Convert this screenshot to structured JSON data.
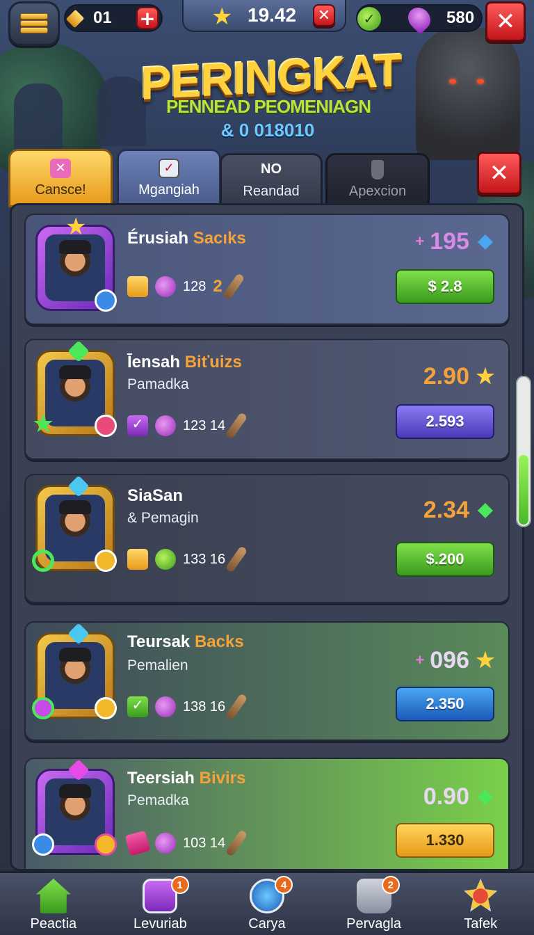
{
  "topbar": {
    "currency1": "01",
    "center_value": "19.42",
    "currency3": "580"
  },
  "title": {
    "main": "PERINGKAT",
    "subtitle": "PENNEAD PEOMENIAGN",
    "code": "& 0 018010"
  },
  "tabs": [
    {
      "label": "Cansce!",
      "icon": "ribbon-icon",
      "active": false
    },
    {
      "label": "Mgangiah",
      "icon": "checkbox-icon",
      "active": true
    },
    {
      "label": "Reandad",
      "icon_text": "NO"
    },
    {
      "label": "Apexcion",
      "icon": "potion-icon"
    }
  ],
  "rows": [
    {
      "name_a": "Érusiah",
      "name_b": "Sacıks",
      "sub": "",
      "stats": "128",
      "stats_suffix": "2",
      "score_prefix": "+",
      "score": "195",
      "score_icon": "blue-gem-icon",
      "button": "$ 2.8",
      "button_color": "green"
    },
    {
      "name_a": "Īensah",
      "name_b": "Biťuizs",
      "sub": "Pamadka",
      "stats": "123 14",
      "stats_suffix": "",
      "score_prefix": "",
      "score": "2.90",
      "score_icon": "star-icon",
      "button": "2.593",
      "button_color": "purple"
    },
    {
      "name_a": "SiaSan",
      "name_b": "",
      "sub": "& Pemagin",
      "stats": "133 16",
      "stats_suffix": "",
      "score_prefix": "",
      "score": "2.34",
      "score_icon": "green-gem-icon",
      "button": "$.200",
      "button_color": "green"
    },
    {
      "name_a": "Teursak",
      "name_b": "Backs",
      "sub": "Pemalien",
      "stats": "138 16",
      "stats_suffix": "",
      "score_prefix": "+",
      "score": "096",
      "score_icon": "star-icon",
      "button": "2.350",
      "button_color": "blue"
    },
    {
      "name_a": "Teersiah",
      "name_b": "Bivirs",
      "sub": "Pemadka",
      "stats": "103 14",
      "stats_suffix": "",
      "score_prefix": "",
      "score": "0.90",
      "score_icon": "green-gem-icon",
      "button": "1.330",
      "button_color": "gold"
    }
  ],
  "nav": [
    {
      "label": "Peactia",
      "icon": "home-icon",
      "count": ""
    },
    {
      "label": "Levuriab",
      "icon": "checklist-icon",
      "count": "1"
    },
    {
      "label": "Carya",
      "icon": "clock-icon",
      "count": "4"
    },
    {
      "label": "Pervagla",
      "icon": "bag-icon",
      "count": "2"
    },
    {
      "label": "Tafek",
      "icon": "emblem-icon",
      "count": ""
    }
  ],
  "colors": {
    "accent_gold": "#ffd23e",
    "accent_green": "#4ab82a",
    "close_red": "#c4161c"
  }
}
